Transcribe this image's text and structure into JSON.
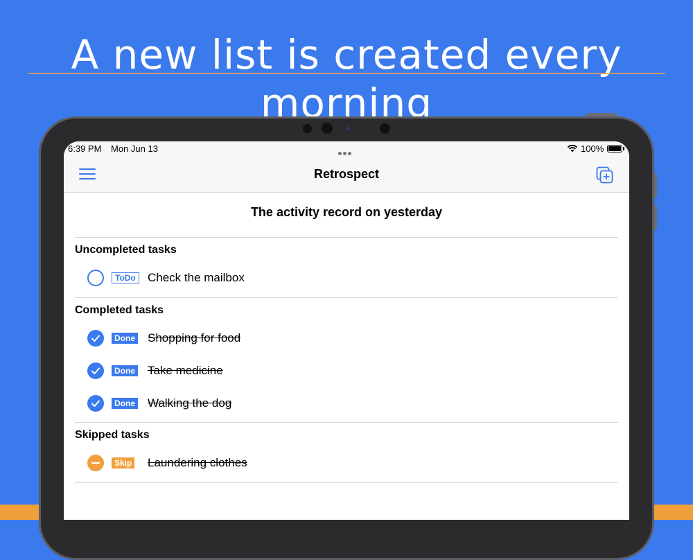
{
  "headline": "A new list is created every morning",
  "status_bar": {
    "time": "6:39 PM",
    "date": "Mon Jun 13",
    "battery": "100%"
  },
  "nav": {
    "title": "Retrospect"
  },
  "record_title": "The activity record on yesterday",
  "sections": {
    "uncompleted": {
      "label": "Uncompleted tasks"
    },
    "completed": {
      "label": "Completed tasks"
    },
    "skipped": {
      "label": "Skipped tasks"
    }
  },
  "tasks": {
    "uncompleted": [
      {
        "tag": "ToDo",
        "text": "Check the mailbox"
      }
    ],
    "completed": [
      {
        "tag": "Done",
        "text": "Shopping for food"
      },
      {
        "tag": "Done",
        "text": "Take medicine"
      },
      {
        "tag": "Done",
        "text": "Walking the dog"
      }
    ],
    "skipped": [
      {
        "tag": "Skip",
        "text": "Laundering clothes"
      }
    ]
  },
  "icons": {
    "menu": "hamburger-menu-icon",
    "add": "add-copy-icon",
    "open_circle": "empty-circle-icon",
    "done": "checkmark-circle-icon",
    "skip": "minus-circle-icon",
    "wifi": "wifi-icon",
    "battery": "battery-icon"
  },
  "colors": {
    "background": "#3B7AEC",
    "accent": "#3B7AEC",
    "skip": "#F0A03A",
    "headline_text": "#FFFFFF"
  }
}
